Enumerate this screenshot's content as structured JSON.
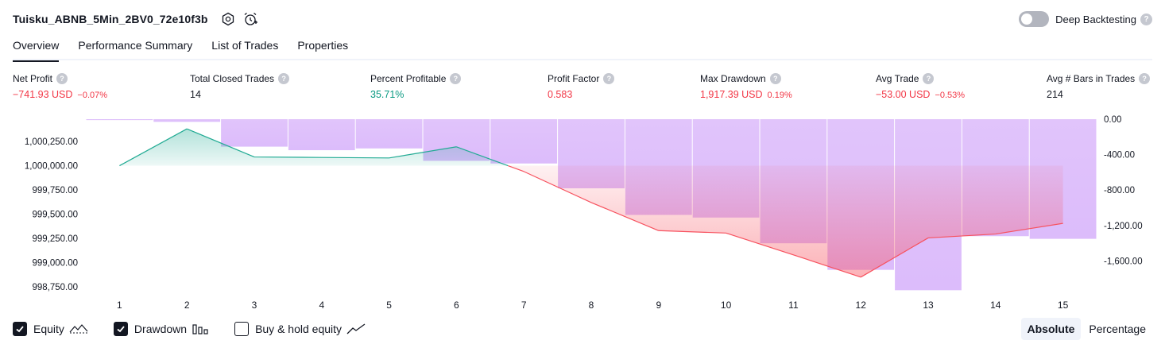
{
  "header": {
    "strategy_name": "Tuisku_ABNB_5Min_2BV0_72e10f3b",
    "settings_icon": "gear-icon",
    "alert_icon": "alarm-clock-add-icon",
    "deep_backtesting_label": "Deep Backtesting",
    "deep_backtesting_enabled": false,
    "help_glyph": "?"
  },
  "tabs": [
    {
      "label": "Overview",
      "active": true
    },
    {
      "label": "Performance Summary",
      "active": false
    },
    {
      "label": "List of Trades",
      "active": false
    },
    {
      "label": "Properties",
      "active": false
    }
  ],
  "metrics": [
    {
      "label": "Net Profit",
      "value": "−741.93 USD",
      "pct": "−0.07%",
      "tone": "neg"
    },
    {
      "label": "Total Closed Trades",
      "value": "14",
      "pct": "",
      "tone": "neu"
    },
    {
      "label": "Percent Profitable",
      "value": "35.71%",
      "pct": "",
      "tone": "pos"
    },
    {
      "label": "Profit Factor",
      "value": "0.583",
      "pct": "",
      "tone": "neg"
    },
    {
      "label": "Max Drawdown",
      "value": "1,917.39 USD",
      "pct": "0.19%",
      "tone": "neg"
    },
    {
      "label": "Avg Trade",
      "value": "−53.00 USD",
      "pct": "−0.53%",
      "tone": "neg"
    },
    {
      "label": "Avg # Bars in Trades",
      "value": "214",
      "pct": "",
      "tone": "neu"
    }
  ],
  "chart_data": {
    "type": "line",
    "x": [
      1,
      2,
      3,
      4,
      5,
      6,
      7,
      8,
      9,
      10,
      11,
      12,
      13,
      14,
      15
    ],
    "left_axis": {
      "ticks": [
        1000250,
        1000000,
        999750,
        999500,
        999250,
        999000,
        998750
      ],
      "tick_labels": [
        "1,000,250.00",
        "1,000,000.00",
        "999,750.00",
        "999,500.00",
        "999,250.00",
        "999,000.00",
        "998,750.00"
      ],
      "ylim": [
        998660,
        1000480
      ]
    },
    "right_axis": {
      "ticks": [
        0,
        -400,
        -800,
        -1200,
        -1600
      ],
      "tick_labels": [
        "0.00",
        "-400.00",
        "-800.00",
        "-1,200.00",
        "-1,600.00"
      ],
      "ylim": [
        -1990,
        0
      ]
    },
    "baseline": 1000000,
    "series": [
      {
        "name": "Equity",
        "axis": "left",
        "values": [
          1000000,
          1000380,
          1000090,
          1000085,
          1000080,
          1000195,
          999940,
          999620,
          999330,
          999305,
          999080,
          998850,
          999255,
          999295,
          999405
        ],
        "colors": {
          "profit_line": "#22ab94",
          "loss_line": "#f7525f"
        }
      },
      {
        "name": "Drawdown",
        "axis": "right",
        "values": [
          -10,
          -30,
          -310,
          -350,
          -330,
          -470,
          -500,
          -780,
          -1080,
          -1110,
          -1400,
          -1700,
          -1930,
          -1320,
          -1350
        ],
        "color": "#ce93d8"
      }
    ],
    "legend": [
      {
        "name": "Equity",
        "checked": true,
        "icon": "equity-line-icon"
      },
      {
        "name": "Drawdown",
        "checked": true,
        "icon": "drawdown-bars-icon"
      },
      {
        "name": "Buy & hold equity",
        "checked": false,
        "icon": "buy-hold-line-icon"
      }
    ]
  },
  "view_mode": {
    "options": [
      "Absolute",
      "Percentage"
    ],
    "selected": "Absolute"
  }
}
